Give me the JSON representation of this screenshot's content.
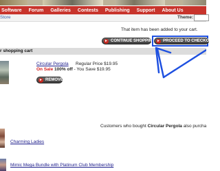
{
  "nav": {
    "items": [
      {
        "label": "Software"
      },
      {
        "label": "Forum"
      },
      {
        "label": "Galleries"
      },
      {
        "label": "Contests"
      },
      {
        "label": "Publishing"
      },
      {
        "label": "Support"
      },
      {
        "label": "About Us"
      }
    ]
  },
  "subbar": {
    "store_link": "Store",
    "theme_label": "Theme:"
  },
  "cart": {
    "added_message": "That item has been added to your cart.",
    "continue_label": "CONTINUE SHOPPING",
    "proceed_label": "PROCEED TO CHECKOUT",
    "section_title": "r shopping cart",
    "item": {
      "name": "Circular Pergola",
      "regular_price": "Regular Price $19.95",
      "on_sale": "On Sale",
      "discount": "100% off",
      "you_save": "- You Save $19.95",
      "remove_label": "REMOVE"
    }
  },
  "also_purchased": {
    "prefix": "Customers who bought",
    "product": "Circular Pergola",
    "suffix": "also purcha",
    "items": [
      {
        "label": "Charming Ladies"
      },
      {
        "label": "Mimic Mega Bundle with Platinum Club Membership"
      }
    ]
  },
  "colors": {
    "nav_bg": "#c8342c",
    "highlight": "#1e50e0",
    "sale_red": "#d21a1a"
  },
  "icons": [
    "play-circle-icon",
    "annotation-arrow"
  ]
}
